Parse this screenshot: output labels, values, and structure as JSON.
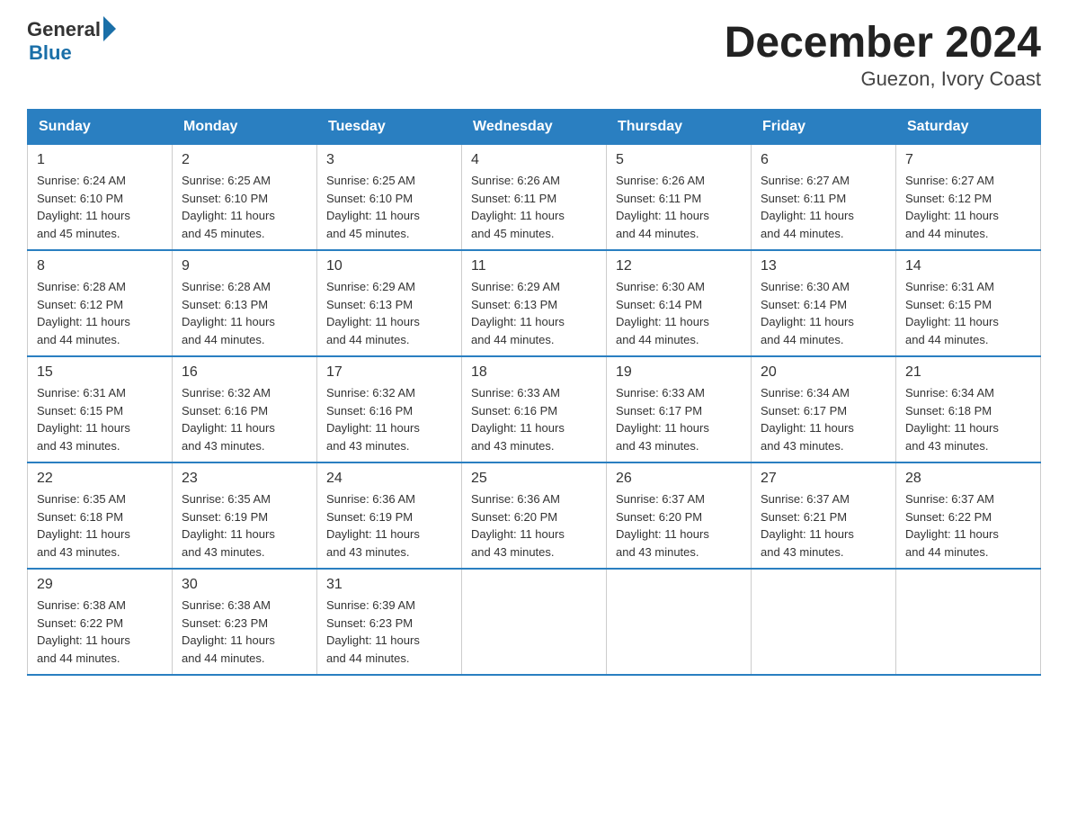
{
  "logo": {
    "general": "General",
    "blue": "Blue"
  },
  "title": "December 2024",
  "subtitle": "Guezon, Ivory Coast",
  "days_of_week": [
    "Sunday",
    "Monday",
    "Tuesday",
    "Wednesday",
    "Thursday",
    "Friday",
    "Saturday"
  ],
  "weeks": [
    [
      {
        "day": "1",
        "sunrise": "6:24 AM",
        "sunset": "6:10 PM",
        "daylight": "11 hours and 45 minutes."
      },
      {
        "day": "2",
        "sunrise": "6:25 AM",
        "sunset": "6:10 PM",
        "daylight": "11 hours and 45 minutes."
      },
      {
        "day": "3",
        "sunrise": "6:25 AM",
        "sunset": "6:10 PM",
        "daylight": "11 hours and 45 minutes."
      },
      {
        "day": "4",
        "sunrise": "6:26 AM",
        "sunset": "6:11 PM",
        "daylight": "11 hours and 45 minutes."
      },
      {
        "day": "5",
        "sunrise": "6:26 AM",
        "sunset": "6:11 PM",
        "daylight": "11 hours and 44 minutes."
      },
      {
        "day": "6",
        "sunrise": "6:27 AM",
        "sunset": "6:11 PM",
        "daylight": "11 hours and 44 minutes."
      },
      {
        "day": "7",
        "sunrise": "6:27 AM",
        "sunset": "6:12 PM",
        "daylight": "11 hours and 44 minutes."
      }
    ],
    [
      {
        "day": "8",
        "sunrise": "6:28 AM",
        "sunset": "6:12 PM",
        "daylight": "11 hours and 44 minutes."
      },
      {
        "day": "9",
        "sunrise": "6:28 AM",
        "sunset": "6:13 PM",
        "daylight": "11 hours and 44 minutes."
      },
      {
        "day": "10",
        "sunrise": "6:29 AM",
        "sunset": "6:13 PM",
        "daylight": "11 hours and 44 minutes."
      },
      {
        "day": "11",
        "sunrise": "6:29 AM",
        "sunset": "6:13 PM",
        "daylight": "11 hours and 44 minutes."
      },
      {
        "day": "12",
        "sunrise": "6:30 AM",
        "sunset": "6:14 PM",
        "daylight": "11 hours and 44 minutes."
      },
      {
        "day": "13",
        "sunrise": "6:30 AM",
        "sunset": "6:14 PM",
        "daylight": "11 hours and 44 minutes."
      },
      {
        "day": "14",
        "sunrise": "6:31 AM",
        "sunset": "6:15 PM",
        "daylight": "11 hours and 44 minutes."
      }
    ],
    [
      {
        "day": "15",
        "sunrise": "6:31 AM",
        "sunset": "6:15 PM",
        "daylight": "11 hours and 43 minutes."
      },
      {
        "day": "16",
        "sunrise": "6:32 AM",
        "sunset": "6:16 PM",
        "daylight": "11 hours and 43 minutes."
      },
      {
        "day": "17",
        "sunrise": "6:32 AM",
        "sunset": "6:16 PM",
        "daylight": "11 hours and 43 minutes."
      },
      {
        "day": "18",
        "sunrise": "6:33 AM",
        "sunset": "6:16 PM",
        "daylight": "11 hours and 43 minutes."
      },
      {
        "day": "19",
        "sunrise": "6:33 AM",
        "sunset": "6:17 PM",
        "daylight": "11 hours and 43 minutes."
      },
      {
        "day": "20",
        "sunrise": "6:34 AM",
        "sunset": "6:17 PM",
        "daylight": "11 hours and 43 minutes."
      },
      {
        "day": "21",
        "sunrise": "6:34 AM",
        "sunset": "6:18 PM",
        "daylight": "11 hours and 43 minutes."
      }
    ],
    [
      {
        "day": "22",
        "sunrise": "6:35 AM",
        "sunset": "6:18 PM",
        "daylight": "11 hours and 43 minutes."
      },
      {
        "day": "23",
        "sunrise": "6:35 AM",
        "sunset": "6:19 PM",
        "daylight": "11 hours and 43 minutes."
      },
      {
        "day": "24",
        "sunrise": "6:36 AM",
        "sunset": "6:19 PM",
        "daylight": "11 hours and 43 minutes."
      },
      {
        "day": "25",
        "sunrise": "6:36 AM",
        "sunset": "6:20 PM",
        "daylight": "11 hours and 43 minutes."
      },
      {
        "day": "26",
        "sunrise": "6:37 AM",
        "sunset": "6:20 PM",
        "daylight": "11 hours and 43 minutes."
      },
      {
        "day": "27",
        "sunrise": "6:37 AM",
        "sunset": "6:21 PM",
        "daylight": "11 hours and 43 minutes."
      },
      {
        "day": "28",
        "sunrise": "6:37 AM",
        "sunset": "6:22 PM",
        "daylight": "11 hours and 44 minutes."
      }
    ],
    [
      {
        "day": "29",
        "sunrise": "6:38 AM",
        "sunset": "6:22 PM",
        "daylight": "11 hours and 44 minutes."
      },
      {
        "day": "30",
        "sunrise": "6:38 AM",
        "sunset": "6:23 PM",
        "daylight": "11 hours and 44 minutes."
      },
      {
        "day": "31",
        "sunrise": "6:39 AM",
        "sunset": "6:23 PM",
        "daylight": "11 hours and 44 minutes."
      },
      null,
      null,
      null,
      null
    ]
  ],
  "labels": {
    "sunrise": "Sunrise:",
    "sunset": "Sunset:",
    "daylight": "Daylight:"
  }
}
